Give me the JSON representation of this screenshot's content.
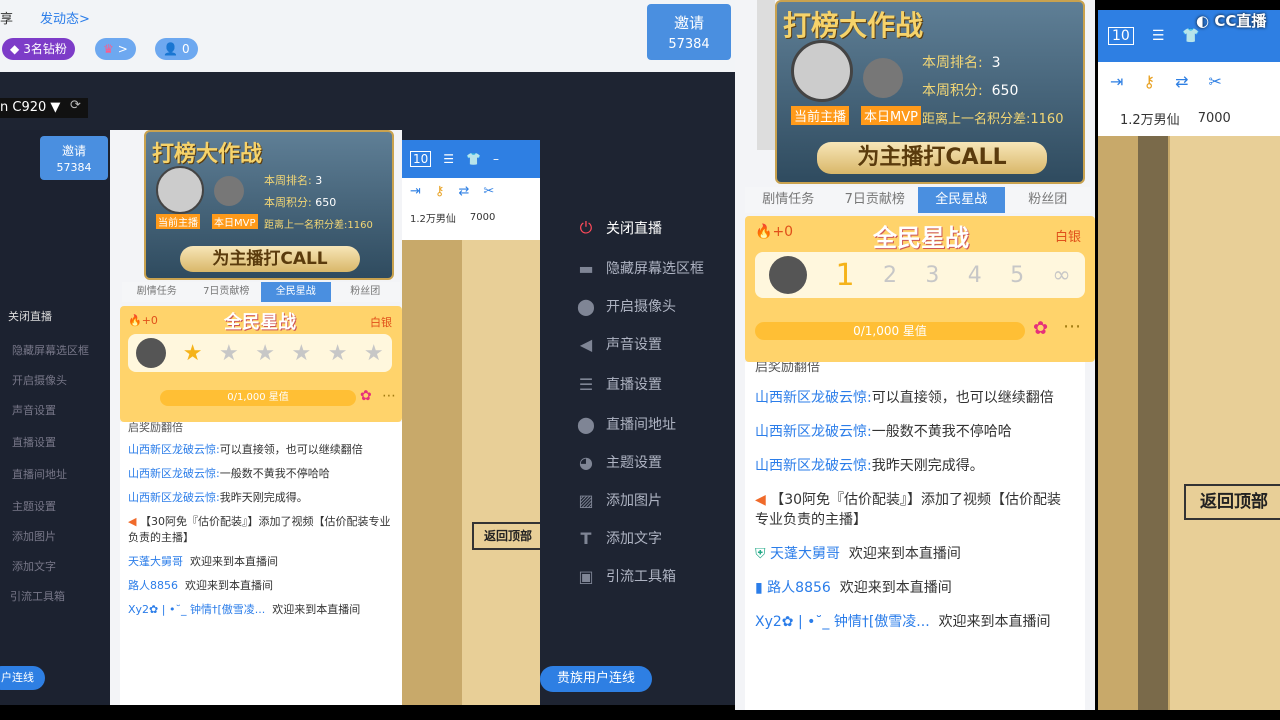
{
  "topbar": {
    "left_fragment": "享",
    "post_dynamic": "发动态>",
    "diamond_fans": "3名钻粉",
    "badge_arrow": ">",
    "viewer_count": "0"
  },
  "invite": {
    "label": "邀请",
    "count": "57384"
  },
  "camera": {
    "selected": "n C920"
  },
  "menu": {
    "items": [
      {
        "label": "关闭直播",
        "icon": "power-icon"
      },
      {
        "label": "隐藏屏幕选区框",
        "icon": "screen-icon"
      },
      {
        "label": "开启摄像头",
        "icon": "location-icon"
      },
      {
        "label": "声音设置",
        "icon": "speaker-icon"
      },
      {
        "label": "直播设置",
        "icon": "sliders-icon"
      },
      {
        "label": "直播间地址",
        "icon": "location-icon"
      },
      {
        "label": "主题设置",
        "icon": "palette-icon"
      },
      {
        "label": "添加图片",
        "icon": "image-icon"
      },
      {
        "label": "添加文字",
        "icon": "text-icon"
      },
      {
        "label": "引流工具箱",
        "icon": "toolbox-icon"
      }
    ],
    "noble_link": "贵族用户连线",
    "noble_link_short": "户连线"
  },
  "banner": {
    "title": "打榜大作战",
    "rank_label": "本周排名:",
    "rank": "3",
    "score_label": "本周积分:",
    "score": "650",
    "current_host": "当前主播",
    "mvp": "本日MVP",
    "gap": "距离上一名积分差:1160",
    "call": "为主播打CALL"
  },
  "tabs": [
    "剧情任务",
    "7日贡献榜",
    "全民星战",
    "粉丝团"
  ],
  "star_card": {
    "fire": "+0",
    "title": "全民星战",
    "level": "白银",
    "stars": [
      "1",
      "2",
      "3",
      "4",
      "5",
      "∞"
    ],
    "progress": "0/1,000 星值"
  },
  "chat": {
    "truncated_line": "启奖励翻倍",
    "messages": [
      {
        "user": "山西新区龙破云惊:",
        "text": "可以直接领，也可以继续翻倍"
      },
      {
        "user": "山西新区龙破云惊:",
        "text": "一般数不黄我不停哈哈"
      },
      {
        "user": "山西新区龙破云惊:",
        "text": "我昨天刚完成得。"
      }
    ],
    "system": "【30阿免『估价配装』】添加了视频【估价配装专业负责的主播】",
    "welcomes": [
      {
        "user": "天蓬大舅哥",
        "text": "欢迎来到本直播间"
      },
      {
        "user": "路人8856",
        "text": "欢迎来到本直播间"
      },
      {
        "user": "Xy2✿ | •˘_ 钟情†[傲雪凌...",
        "text": "欢迎来到本直播间"
      }
    ]
  },
  "browser": {
    "tab_count": "10",
    "bookmarks": [
      "1.2万男仙",
      "7000"
    ]
  },
  "game": {
    "back_top": "返回顶部"
  },
  "watermark": "CC直播",
  "colors": {
    "accent": "#2e7fe3",
    "dark": "#1e2432",
    "gold": "#ffd36b"
  }
}
